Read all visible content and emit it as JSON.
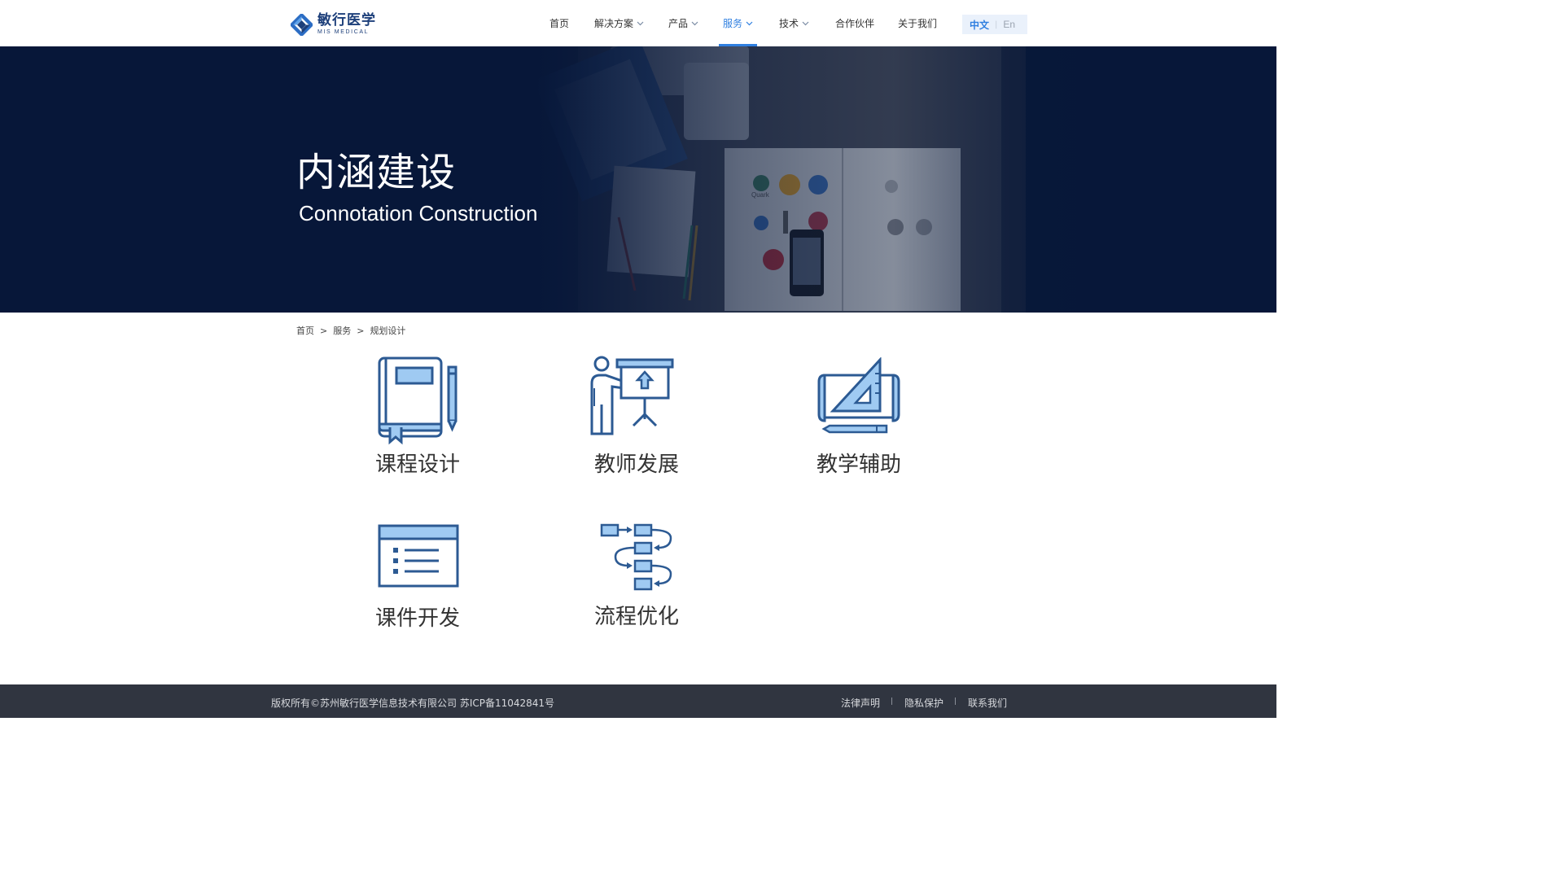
{
  "header": {
    "logo": {
      "name_cn": "敏行医学",
      "name_en": "MIS MEDICAL"
    },
    "nav": [
      {
        "label": "首页",
        "has_dropdown": false,
        "active": false
      },
      {
        "label": "解决方案",
        "has_dropdown": true,
        "active": false
      },
      {
        "label": "产品",
        "has_dropdown": true,
        "active": false
      },
      {
        "label": "服务",
        "has_dropdown": true,
        "active": true
      },
      {
        "label": "技术",
        "has_dropdown": true,
        "active": false
      },
      {
        "label": "合作伙伴",
        "has_dropdown": false,
        "active": false
      },
      {
        "label": "关于我们",
        "has_dropdown": false,
        "active": false
      }
    ],
    "lang": {
      "zh": "中文",
      "separator": "|",
      "en": "En",
      "selected": "中文"
    }
  },
  "banner": {
    "title": "内涵建设",
    "subtitle": "Connotation Construction"
  },
  "breadcrumb": {
    "items": [
      "首页",
      "服务",
      "规划设计"
    ],
    "separator": ">"
  },
  "services": [
    {
      "label": "课程设计",
      "icon": "book-pencil-icon"
    },
    {
      "label": "教师发展",
      "icon": "presenter-board-icon"
    },
    {
      "label": "教学辅助",
      "icon": "blueprint-ruler-icon"
    },
    {
      "label": "课件开发",
      "icon": "document-list-icon"
    },
    {
      "label": "流程优化",
      "icon": "flowchart-icon"
    }
  ],
  "footer": {
    "copyright": "版权所有©苏州敏行医学信息技术有限公司  苏ICP备11042841号",
    "links": [
      "法律声明",
      "隐私保护",
      "联系我们"
    ]
  },
  "colors": {
    "accent": "#2f7fe0",
    "brand_dark": "#1d3f7a",
    "icon_stroke": "#2c5a93",
    "icon_fill": "#9fcaf2",
    "banner_bg": "#071739",
    "footer_bg": "#303540"
  }
}
